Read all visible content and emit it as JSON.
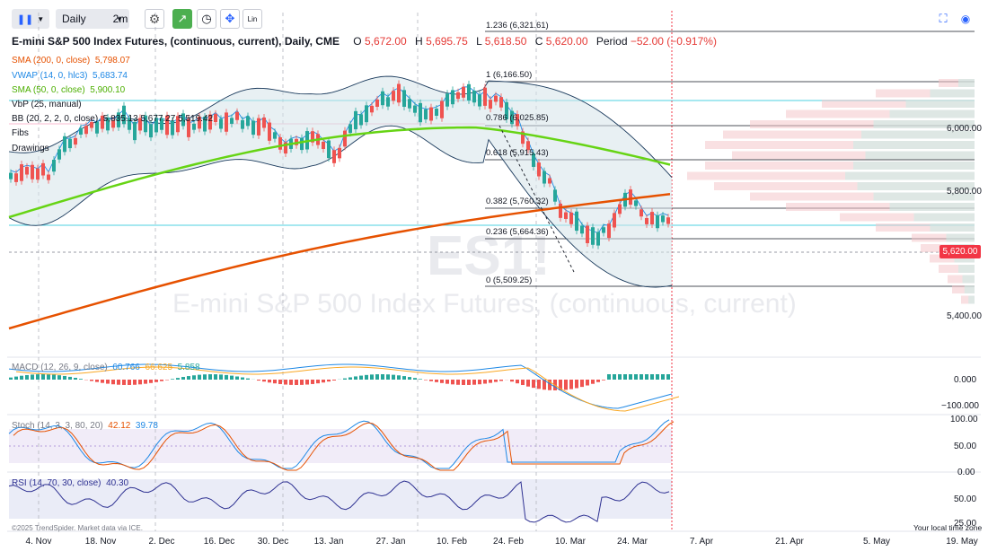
{
  "toolbar": {
    "interval": "Daily",
    "interval2": "2m",
    "lin": "Lin"
  },
  "title": {
    "symbol": "E-mini S&P 500 Index Futures, (continuous, current), Daily, CME",
    "o_label": "O",
    "o": "5,672.00",
    "h_label": "H",
    "h": "5,695.75",
    "l_label": "L",
    "l": "5,618.50",
    "c_label": "C",
    "c": "5,620.00",
    "period_label": "Period",
    "period": "−52.00 (−0.917%)"
  },
  "indicators": [
    {
      "name": "SMA (200, 0, close)",
      "value": "5,798.07",
      "color": "#e65100"
    },
    {
      "name": "VWAP (14, 0, hlc3)",
      "value": "5,683.74",
      "color": "#1e88e5"
    },
    {
      "name": "SMA (50, 0, close)",
      "value": "5,900.10",
      "color": "#66d414"
    },
    {
      "name": "VbP (25, manual)",
      "value": "",
      "color": "#131722"
    },
    {
      "name": "BB (20, 2, 2, 0, close)",
      "value": "5,835.13 5,677.27 5,519.42",
      "color": "#131722"
    },
    {
      "name": "Fibs",
      "value": "",
      "color": "#131722"
    },
    {
      "name": "Drawings",
      "value": "",
      "color": "#131722"
    }
  ],
  "fibs": [
    {
      "label": "1.236 (6,321.61)"
    },
    {
      "label": "1 (6,166.50)"
    },
    {
      "label": "0.786 (6,025.85)"
    },
    {
      "label": "0.618 (5,915.43)"
    },
    {
      "label": "0.382 (5,760.32)"
    },
    {
      "label": "0.236 (5,664.36)"
    },
    {
      "label": "0 (5,509.25)"
    }
  ],
  "price_axis": {
    "labels": [
      "6,000.00",
      "5,800.00",
      "5,400.00"
    ],
    "last_price": "5,620.00"
  },
  "watermark": {
    "ticker": "ES1!",
    "name": "E-mini S&P 500 Index Futures, (continuous, current)"
  },
  "macd": {
    "name": "MACD (12, 26, 9, close)",
    "v1": "60.766",
    "v2": "66.625",
    "v3": "5.858",
    "axis": [
      "0.000",
      "−100.000"
    ]
  },
  "stoch": {
    "name": "Stoch (14, 3, 3, 80, 20)",
    "v1": "42.12",
    "v2": "39.78",
    "axis": [
      "100.00",
      "50.00",
      "0.00"
    ]
  },
  "rsi": {
    "name": "RSI (14, 70, 30, close)",
    "v1": "40.30",
    "axis": [
      "50.00",
      "25.00"
    ]
  },
  "x_axis": [
    "4. Nov",
    "18. Nov",
    "2. Dec",
    "16. Dec",
    "30. Dec",
    "13. Jan",
    "27. Jan",
    "10. Feb",
    "24. Feb",
    "10. Mar",
    "24. Mar",
    "7. Apr",
    "21. Apr",
    "5. May",
    "19. May"
  ],
  "footer": {
    "credit": "©2025 TrendSpider. Market data via ICE.",
    "local_time": "Your local time zone"
  }
}
